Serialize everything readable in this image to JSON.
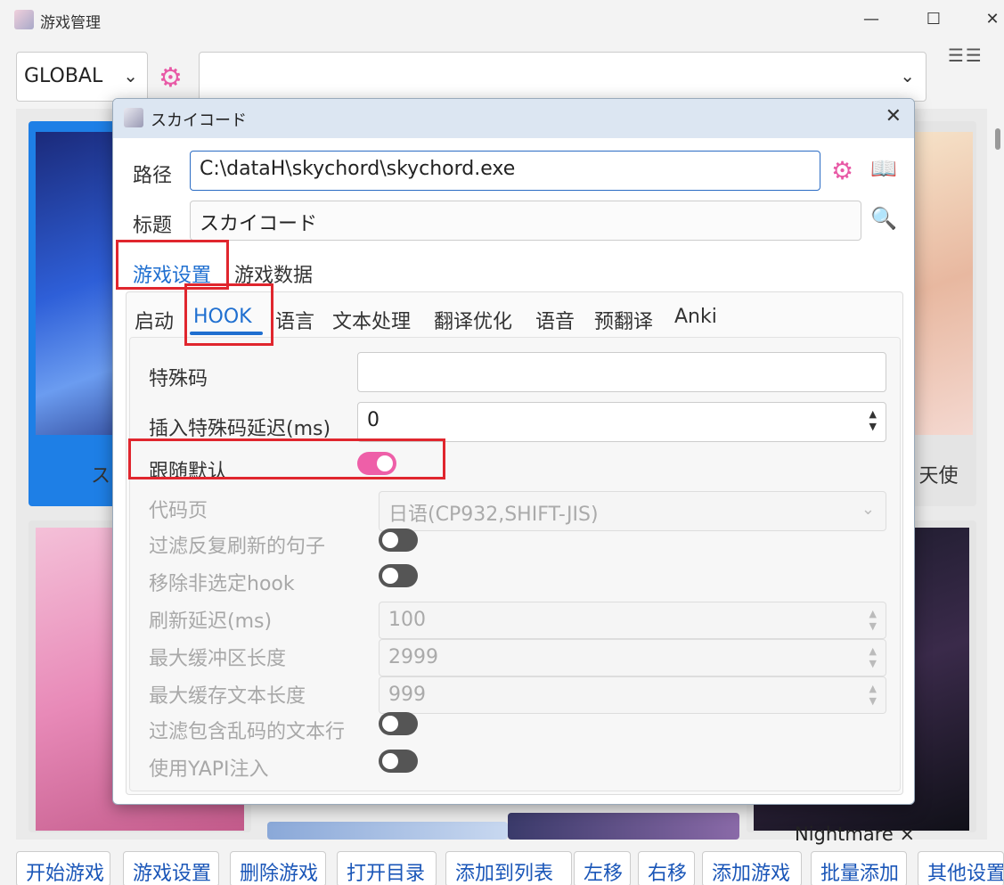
{
  "window": {
    "title": "游戏管理",
    "minimize": "—",
    "maximize": "☐",
    "close": "✕",
    "view_icons": "☰☰"
  },
  "toolbar": {
    "global_select": "GLOBAL",
    "chevron": "⌄",
    "gear": "⚙",
    "combo_value": ""
  },
  "grid": {
    "cards": [
      {
        "label": "スカ"
      },
      {
        "label": "I 天使"
      }
    ],
    "nightmare_label": "Nightmare ×"
  },
  "bottom_buttons": [
    "开始游戏",
    "游戏设置",
    "删除游戏",
    "打开目录",
    "添加到列表",
    "左移",
    "右移",
    "添加游戏",
    "批量添加",
    "其他设置"
  ],
  "dialog": {
    "title": "スカイコード",
    "close": "✕",
    "path_label": "路径",
    "path_value": "C:\\dataH\\skychord\\skychord.exe",
    "title_label": "标题",
    "title_value": "スカイコード",
    "icons": {
      "gear": "⚙",
      "book": "📖",
      "search": "🔍"
    },
    "section_tabs": [
      {
        "label": "游戏设置",
        "active": true
      },
      {
        "label": "游戏数据",
        "active": false
      }
    ],
    "tabs": [
      {
        "label": "启动"
      },
      {
        "label": "HOOK"
      },
      {
        "label": "语言"
      },
      {
        "label": "文本处理"
      },
      {
        "label": "翻译优化"
      },
      {
        "label": "语音"
      },
      {
        "label": "预翻译"
      },
      {
        "label": "Anki"
      }
    ],
    "hook": {
      "special_code_label": "特殊码",
      "special_code_value": "",
      "insert_delay_label": "插入特殊码延迟(ms)",
      "insert_delay_value": "0",
      "follow_default_label": "跟随默认",
      "follow_default_on": true,
      "codepage_label": "代码页",
      "codepage_value": "日语(CP932,SHIFT-JIS)",
      "filter_repeat_label": "过滤反复刷新的句子",
      "remove_unselected_label": "移除非选定hook",
      "refresh_delay_label": "刷新延迟(ms)",
      "refresh_delay_value": "100",
      "max_buffer_label": "最大缓冲区长度",
      "max_buffer_value": "2999",
      "max_cache_label": "最大缓存文本长度",
      "max_cache_value": "999",
      "filter_garbled_label": "过滤包含乱码的文本行",
      "yapi_label": "使用YAPI注入"
    },
    "spin_arrows": "▲\n▼"
  },
  "colors": {
    "accent_pink": "#e85aa6",
    "active_blue": "#1f6fd0",
    "highlight_red": "#e0262e"
  }
}
